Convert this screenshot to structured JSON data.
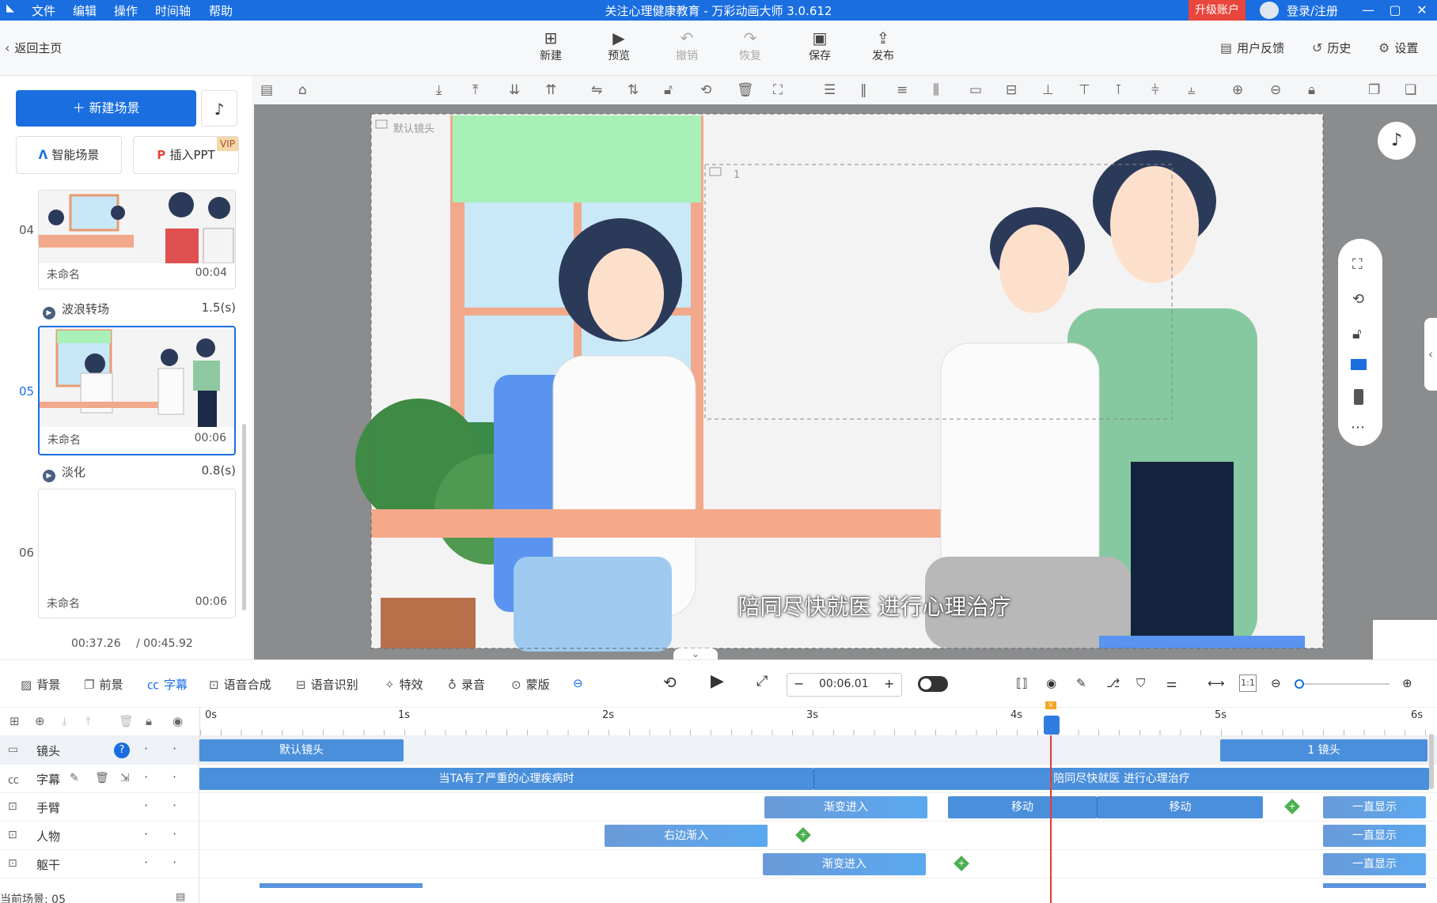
{
  "titlebar": {
    "menu": [
      "文件",
      "编辑",
      "操作",
      "时间轴",
      "帮助"
    ],
    "title": "关注心理健康教育 - 万彩动画大师 3.0.612",
    "upgrade": "升级账户",
    "login": "登录/注册"
  },
  "toolbar": {
    "back": "返回主页",
    "buttons": [
      "新建",
      "预览",
      "撤销",
      "恢复",
      "保存",
      "发布"
    ],
    "feedback": "用户反馈",
    "history": "历史",
    "settings": "设置"
  },
  "left": {
    "new_scene": "新建场景",
    "smart_scene": "智能场景",
    "insert_ppt": "插入PPT",
    "vip": "VIP",
    "scenes": [
      {
        "num": "04",
        "name": "未命名",
        "time": "00:04"
      },
      {
        "num": "05",
        "name": "未命名",
        "time": "00:06"
      },
      {
        "num": "06",
        "name": "未命名",
        "time": "00:06"
      }
    ],
    "transitions": [
      {
        "name": "波浪转场",
        "dur": "1.5(s)"
      },
      {
        "name": "淡化",
        "dur": "0.8(s)"
      }
    ],
    "time_current": "00:37.26",
    "time_total": "/ 00:45.92"
  },
  "canvas": {
    "camera_label": "默认镜头",
    "camera2_label": "1",
    "subtitle": "陪同尽快就医 进行心理治疗"
  },
  "timeline": {
    "buttons": [
      "背景",
      "前景",
      "字幕",
      "语音合成",
      "语音识别",
      "特效",
      "录音",
      "蒙版"
    ],
    "time": "00:06.01",
    "ratio": "1:1",
    "ruler": [
      "0s",
      "1s",
      "2s",
      "3s",
      "4s",
      "5s",
      "6s"
    ],
    "tracks": [
      {
        "name": "镜头",
        "clips": [
          "默认镜头",
          "1 镜头"
        ]
      },
      {
        "name": "字幕",
        "clips": [
          "当TA有了严重的心理疾病时",
          "陪同尽快就医 进行心理治疗"
        ]
      },
      {
        "name": "手臂",
        "clips": [
          "渐变进入",
          "移动",
          "移动",
          "一直显示"
        ]
      },
      {
        "name": "人物",
        "clips": [
          "右边渐入",
          "一直显示"
        ]
      },
      {
        "name": "躯干",
        "clips": [
          "渐变进入",
          "一直显示"
        ]
      }
    ],
    "current_scene": "当前场景: 05"
  },
  "colors": {
    "accent": "#1a6ee0",
    "clip": "#4a8fdc",
    "playhead": "#e53935",
    "keyframe": "#4caf50"
  }
}
